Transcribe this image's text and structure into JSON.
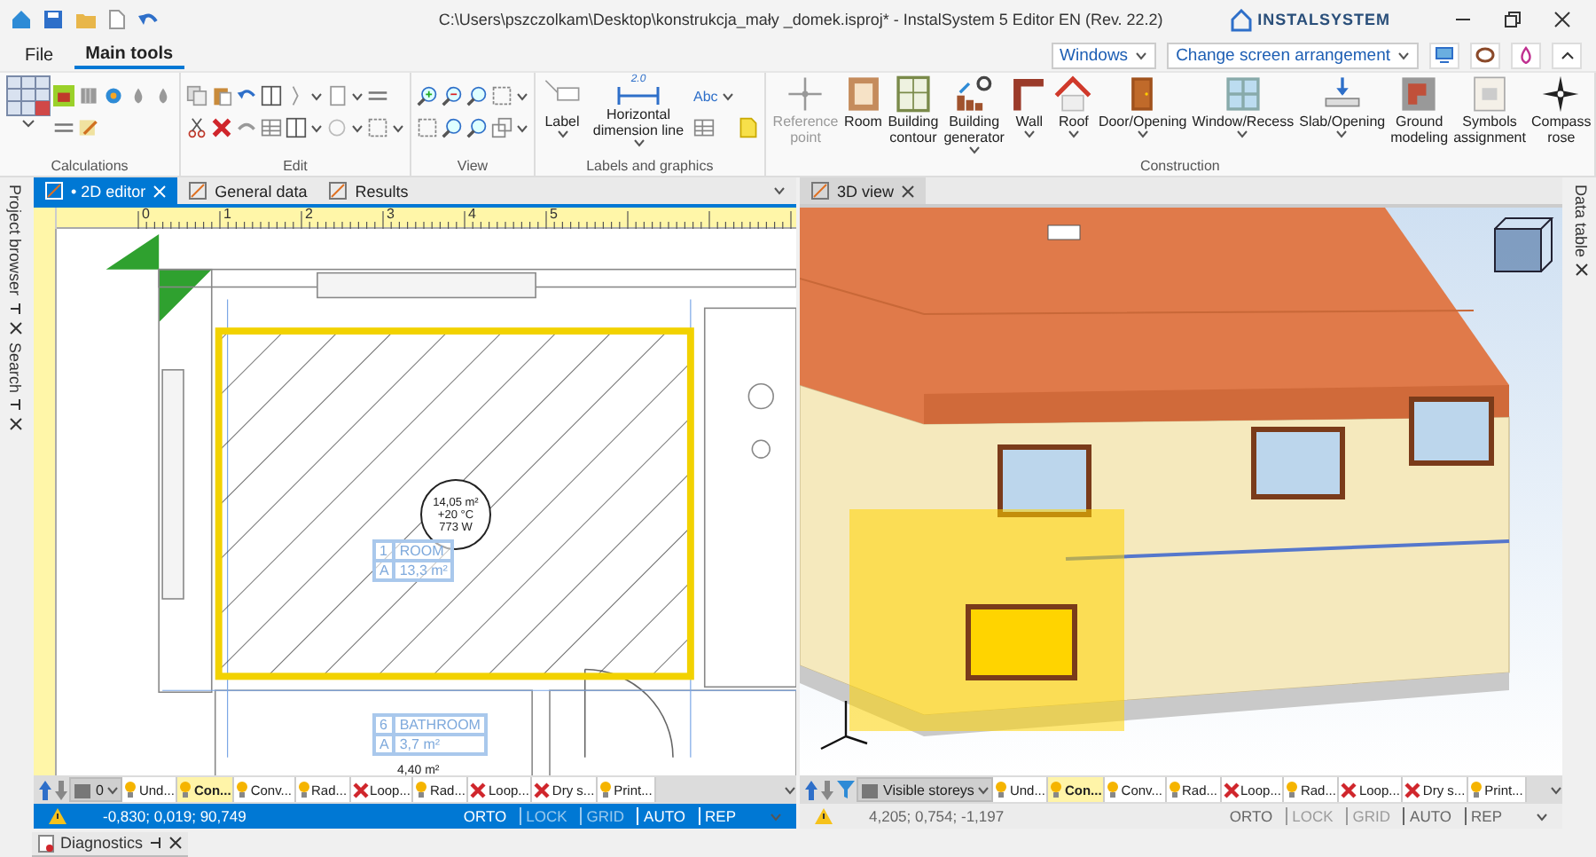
{
  "title_bar": {
    "title": "C:\\Users\\pszczolkam\\Desktop\\konstrukcja_mały _domek.isproj* - InstalSystem 5 Editor EN (Rev. 22.2)",
    "logo": "INSTALSYSTEM"
  },
  "ribbon_tabs": [
    {
      "label": "File",
      "selected": false
    },
    {
      "label": "Main tools",
      "selected": true
    }
  ],
  "ribbon_right": {
    "windows": "Windows",
    "arrangement": "Change screen arrangement"
  },
  "ribbon_groups": [
    {
      "kind": "calculations",
      "label": "Calculations"
    },
    {
      "kind": "edit",
      "label": "Edit"
    },
    {
      "kind": "view",
      "label": "View"
    },
    {
      "kind": "labels",
      "label": "Labels and graphics",
      "buttons": [
        {
          "kind": "label",
          "label": "Label",
          "dropdown": true
        },
        {
          "kind": "dimension",
          "label": "Horizontal dimension line",
          "dropdown": true,
          "icon_text": "2.0"
        }
      ],
      "small_text": "Abc"
    },
    {
      "kind": "construction",
      "label": "Construction",
      "buttons": [
        {
          "kind": "reference",
          "label": "Reference point",
          "dropdown": false,
          "disabled": true
        },
        {
          "kind": "room",
          "label": "Room",
          "dropdown": false,
          "disabled": false
        },
        {
          "kind": "contour",
          "label": "Building contour",
          "dropdown": false,
          "disabled": false
        },
        {
          "kind": "generator",
          "label": "Building generator",
          "dropdown": true,
          "disabled": false
        },
        {
          "kind": "wall",
          "label": "Wall",
          "dropdown": true,
          "disabled": false
        },
        {
          "kind": "roof",
          "label": "Roof",
          "dropdown": true,
          "disabled": false
        },
        {
          "kind": "door",
          "label": "Door/Opening",
          "dropdown": true,
          "disabled": false
        },
        {
          "kind": "window",
          "label": "Window/Recess",
          "dropdown": true,
          "disabled": false
        },
        {
          "kind": "slab",
          "label": "Slab/Opening",
          "dropdown": true,
          "disabled": false
        },
        {
          "kind": "ground",
          "label": "Ground modeling",
          "dropdown": false,
          "disabled": false
        },
        {
          "kind": "symbols",
          "label": "Symbols assignment",
          "dropdown": false,
          "disabled": false
        },
        {
          "kind": "compass",
          "label": "Compass rose",
          "dropdown": false,
          "disabled": false
        }
      ]
    }
  ],
  "left_dock": [
    {
      "label": "Project browser"
    },
    {
      "label": "Search"
    }
  ],
  "right_dock": [
    {
      "label": "Data table"
    }
  ],
  "editor_2d": {
    "active": true,
    "tabs": [
      {
        "label": "• 2D editor",
        "selected": true,
        "closable": true
      },
      {
        "label": "General data",
        "selected": false,
        "closable": false
      },
      {
        "label": "Results",
        "selected": false,
        "closable": false
      }
    ],
    "ruler_labels": [
      "0",
      "1",
      "2",
      "3",
      "4",
      "5"
    ],
    "room_labels": [
      {
        "number": "1",
        "name": "ROOM",
        "code": "A",
        "area": "13,3 m²"
      },
      {
        "number": "6",
        "name": "BATHROOM",
        "code": "A",
        "area": "3,7 m²"
      }
    ],
    "heat_marker": [
      "14,05 m²",
      "+20 °C",
      "773 W"
    ],
    "area_marker": "4,40 m²",
    "layer_bar": {
      "storey_select": "0",
      "filter_button": false,
      "tabs": [
        {
          "kind": "bulb",
          "label": "Und...",
          "selected": false
        },
        {
          "kind": "bulb",
          "label": "Con...",
          "selected": true
        },
        {
          "kind": "bulb",
          "label": "Conv...",
          "selected": false
        },
        {
          "kind": "bulb",
          "label": "Rad...",
          "selected": false
        },
        {
          "kind": "cross",
          "label": "Loop...",
          "selected": false
        },
        {
          "kind": "bulb",
          "label": "Rad...",
          "selected": false
        },
        {
          "kind": "cross",
          "label": "Loop...",
          "selected": false
        },
        {
          "kind": "cross",
          "label": "Dry s...",
          "selected": false
        },
        {
          "kind": "bulb",
          "label": "Print...",
          "selected": false
        }
      ]
    },
    "status": {
      "coordinates": "-0,830; 0,019; 90,749",
      "flags": [
        {
          "label": "ORTO",
          "on": true
        },
        {
          "label": "LOCK",
          "on": false
        },
        {
          "label": "GRID",
          "on": false
        },
        {
          "label": "AUTO",
          "on": true
        },
        {
          "label": "REP",
          "on": true
        }
      ]
    }
  },
  "view_3d": {
    "active": false,
    "tabs": [
      {
        "label": "3D view",
        "selected": true,
        "closable": true
      }
    ],
    "layer_bar": {
      "storey_select": "Visible storeys",
      "filter_button": true,
      "tabs": [
        {
          "kind": "bulb",
          "label": "Und...",
          "selected": false
        },
        {
          "kind": "bulb",
          "label": "Con...",
          "selected": true
        },
        {
          "kind": "bulb",
          "label": "Conv...",
          "selected": false
        },
        {
          "kind": "bulb",
          "label": "Rad...",
          "selected": false
        },
        {
          "kind": "cross",
          "label": "Loop...",
          "selected": false
        },
        {
          "kind": "bulb",
          "label": "Rad...",
          "selected": false
        },
        {
          "kind": "cross",
          "label": "Loop...",
          "selected": false
        },
        {
          "kind": "cross",
          "label": "Dry s...",
          "selected": false
        },
        {
          "kind": "bulb",
          "label": "Print...",
          "selected": false
        }
      ]
    },
    "status": {
      "coordinates": "4,205; 0,754; -1,197",
      "flags": [
        {
          "label": "ORTO",
          "on": true
        },
        {
          "label": "LOCK",
          "on": false
        },
        {
          "label": "GRID",
          "on": false
        },
        {
          "label": "AUTO",
          "on": true
        },
        {
          "label": "REP",
          "on": true
        }
      ]
    }
  },
  "bottom_dock": {
    "tab": "Diagnostics"
  }
}
